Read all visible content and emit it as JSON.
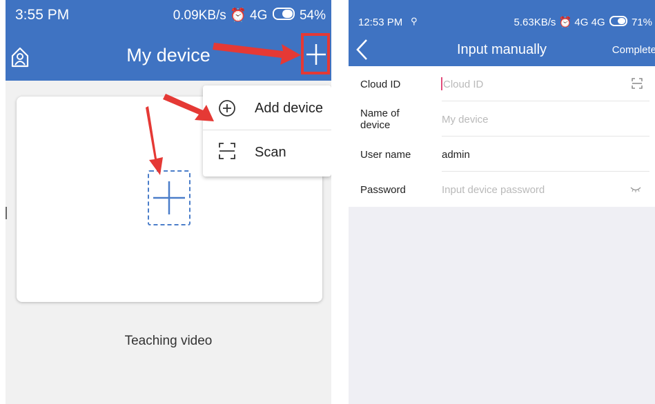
{
  "left_screen": {
    "status_bar": {
      "time": "3:55 PM",
      "net": "0.09KB/s",
      "signal": "4G",
      "battery": "54%"
    },
    "header": {
      "title": "My device"
    },
    "popup_menu": [
      {
        "label": "Add device",
        "icon": "plus-circle-icon"
      },
      {
        "label": "Scan",
        "icon": "scan-icon"
      }
    ],
    "teaching_link": "Teaching video",
    "colors": {
      "header": "#3f73c2",
      "highlight": "#e53935"
    }
  },
  "right_screen": {
    "status_bar": {
      "time": "12:53 PM",
      "net": "5.63KB/s",
      "signal": "4G",
      "signal2": "4G",
      "battery": "71%"
    },
    "header": {
      "title": "Input manually",
      "action": "Complete"
    },
    "form": {
      "cloud_id": {
        "label": "Cloud ID",
        "placeholder": "Cloud ID"
      },
      "device_name": {
        "label": "Name of device",
        "placeholder": "My device"
      },
      "user_name": {
        "label": "User name",
        "value": "admin"
      },
      "password": {
        "label": "Password",
        "placeholder": "Input device password"
      }
    }
  }
}
